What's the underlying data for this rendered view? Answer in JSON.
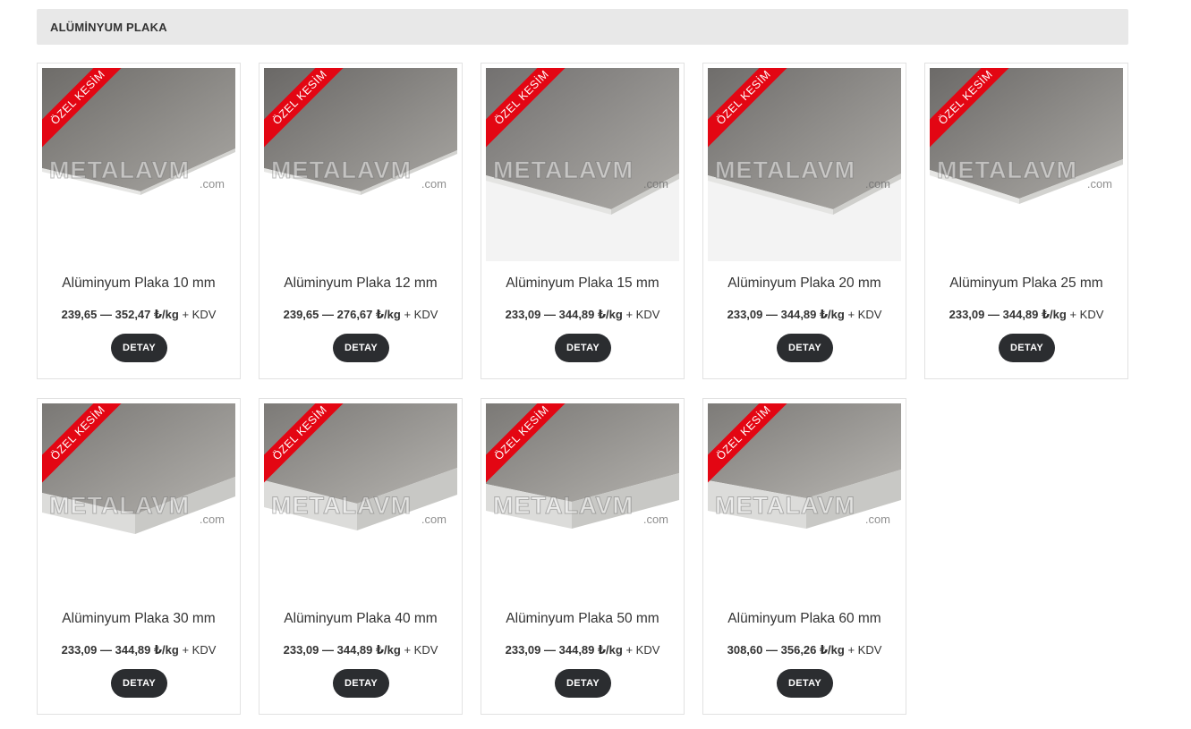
{
  "section": {
    "title": "ALÜMİNYUM PLAKA"
  },
  "products": [
    {
      "name": "Alüminyum Plaka 10 mm",
      "price_min": "239,65",
      "price_max": "352,47 ₺/kg",
      "tax": "+ KDV",
      "ribbon": "ÖZEL KESİM",
      "button": "DETAY",
      "watermark": "METALAVM",
      "watermark_com": ".com"
    },
    {
      "name": "Alüminyum Plaka 12 mm",
      "price_min": "239,65",
      "price_max": "276,67 ₺/kg",
      "tax": "+ KDV",
      "ribbon": "ÖZEL KESİM",
      "button": "DETAY",
      "watermark": "METALAVM",
      "watermark_com": ".com"
    },
    {
      "name": "Alüminyum Plaka 15 mm",
      "price_min": "233,09",
      "price_max": "344,89 ₺/kg",
      "tax": "+ KDV",
      "ribbon": "ÖZEL KESİM",
      "button": "DETAY",
      "watermark": "METALAVM",
      "watermark_com": ".com"
    },
    {
      "name": "Alüminyum Plaka 20 mm",
      "price_min": "233,09",
      "price_max": "344,89 ₺/kg",
      "tax": "+ KDV",
      "ribbon": "ÖZEL KESİM",
      "button": "DETAY",
      "watermark": "METALAVM",
      "watermark_com": ".com"
    },
    {
      "name": "Alüminyum Plaka 25 mm",
      "price_min": "233,09",
      "price_max": "344,89 ₺/kg",
      "tax": "+ KDV",
      "ribbon": "ÖZEL KESİM",
      "button": "DETAY",
      "watermark": "METALAVM",
      "watermark_com": ".com"
    },
    {
      "name": "Alüminyum Plaka 30 mm",
      "price_min": "233,09",
      "price_max": "344,89 ₺/kg",
      "tax": "+ KDV",
      "ribbon": "ÖZEL KESİM",
      "button": "DETAY",
      "watermark": "METALAVM",
      "watermark_com": ".com"
    },
    {
      "name": "Alüminyum Plaka 40 mm",
      "price_min": "233,09",
      "price_max": "344,89 ₺/kg",
      "tax": "+ KDV",
      "ribbon": "ÖZEL KESİM",
      "button": "DETAY",
      "watermark": "METALAVM",
      "watermark_com": ".com"
    },
    {
      "name": "Alüminyum Plaka 50 mm",
      "price_min": "233,09",
      "price_max": "344,89 ₺/kg",
      "tax": "+ KDV",
      "ribbon": "ÖZEL KESİM",
      "button": "DETAY",
      "watermark": "METALAVM",
      "watermark_com": ".com"
    },
    {
      "name": "Alüminyum Plaka 60 mm",
      "price_min": "308,60",
      "price_max": "356,26 ₺/kg",
      "tax": "+ KDV",
      "ribbon": "ÖZEL KESİM",
      "button": "DETAY",
      "watermark": "METALAVM",
      "watermark_com": ".com"
    }
  ],
  "colors": {
    "ribbon": "#e30613",
    "button": "#2b2d30",
    "header_bg": "#e8e8e8"
  }
}
